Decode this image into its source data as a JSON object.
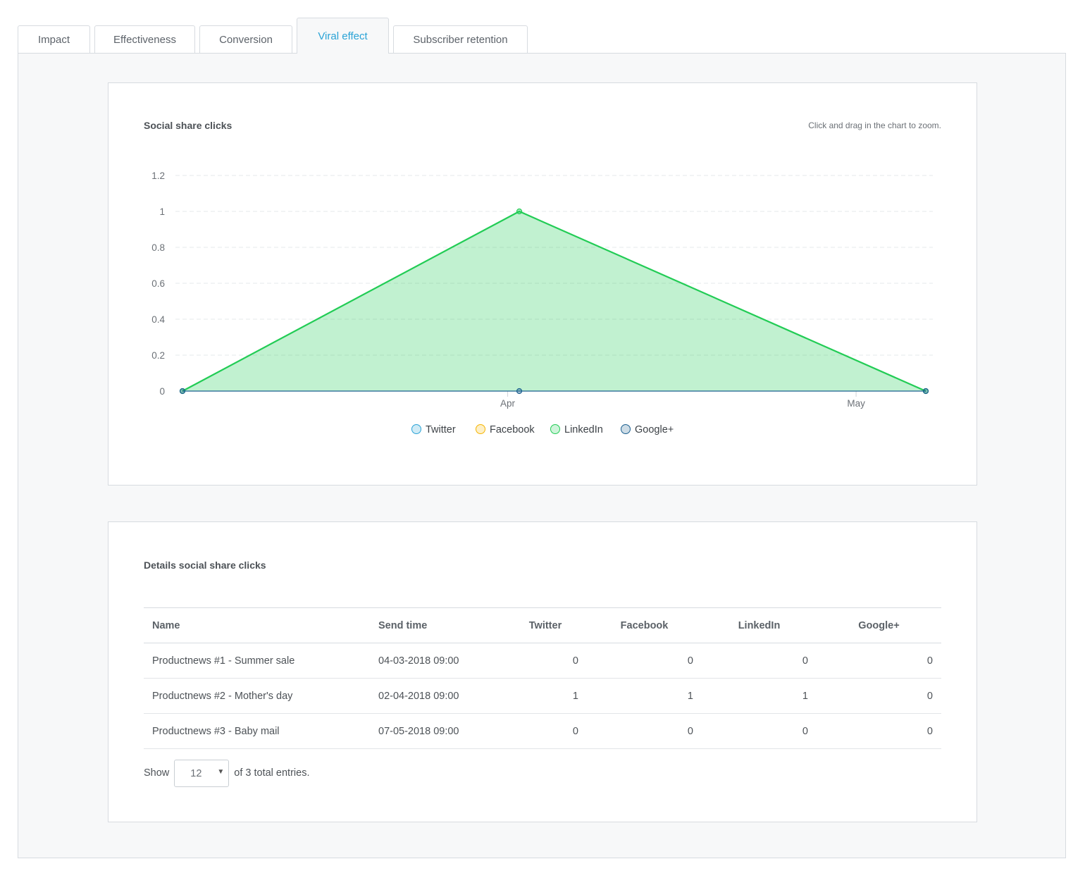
{
  "tabs": [
    {
      "label": "Impact",
      "active": false
    },
    {
      "label": "Effectiveness",
      "active": false
    },
    {
      "label": "Conversion",
      "active": false
    },
    {
      "label": "Viral effect",
      "active": true
    },
    {
      "label": "Subscriber retention",
      "active": false
    }
  ],
  "chart_card": {
    "title": "Social share clicks",
    "zoom_hint": "Click and drag in the chart to zoom."
  },
  "chart_data": {
    "type": "area",
    "title": "Social share clicks",
    "x_ticks": [
      "Apr",
      "May"
    ],
    "x": [
      "2018-03-04",
      "2018-04-02",
      "2018-05-07"
    ],
    "ylim": [
      0,
      1.2
    ],
    "y_ticks": [
      "0",
      "0.2",
      "0.4",
      "0.6",
      "0.8",
      "1",
      "1.2"
    ],
    "grid": true,
    "legend_position": "bottom",
    "series": [
      {
        "name": "Twitter",
        "values": [
          0,
          1,
          0
        ],
        "color": "#2aa3d6",
        "visible": false
      },
      {
        "name": "Facebook",
        "values": [
          0,
          1,
          0
        ],
        "color": "#f5b400",
        "visible": false
      },
      {
        "name": "LinkedIn",
        "values": [
          0,
          1,
          0
        ],
        "color": "#22cc55",
        "visible": true
      },
      {
        "name": "Google+",
        "values": [
          0,
          0,
          0
        ],
        "color": "#1b5f8f",
        "visible": true
      }
    ]
  },
  "table_card": {
    "title": "Details social share clicks",
    "columns": [
      "Name",
      "Send time",
      "Twitter",
      "Facebook",
      "LinkedIn",
      "Google+"
    ],
    "rows": [
      {
        "name": "Productnews #1 - Summer sale",
        "send_time": "04-03-2018 09:00",
        "twitter": "0",
        "facebook": "0",
        "linkedin": "0",
        "googleplus": "0"
      },
      {
        "name": "Productnews #2 - Mother's day",
        "send_time": "02-04-2018 09:00",
        "twitter": "1",
        "facebook": "1",
        "linkedin": "1",
        "googleplus": "0"
      },
      {
        "name": "Productnews #3 - Baby mail",
        "send_time": "07-05-2018 09:00",
        "twitter": "0",
        "facebook": "0",
        "linkedin": "0",
        "googleplus": "0"
      }
    ]
  },
  "pager": {
    "show_label": "Show",
    "page_size": "12",
    "total_text": "of 3 total entries."
  }
}
